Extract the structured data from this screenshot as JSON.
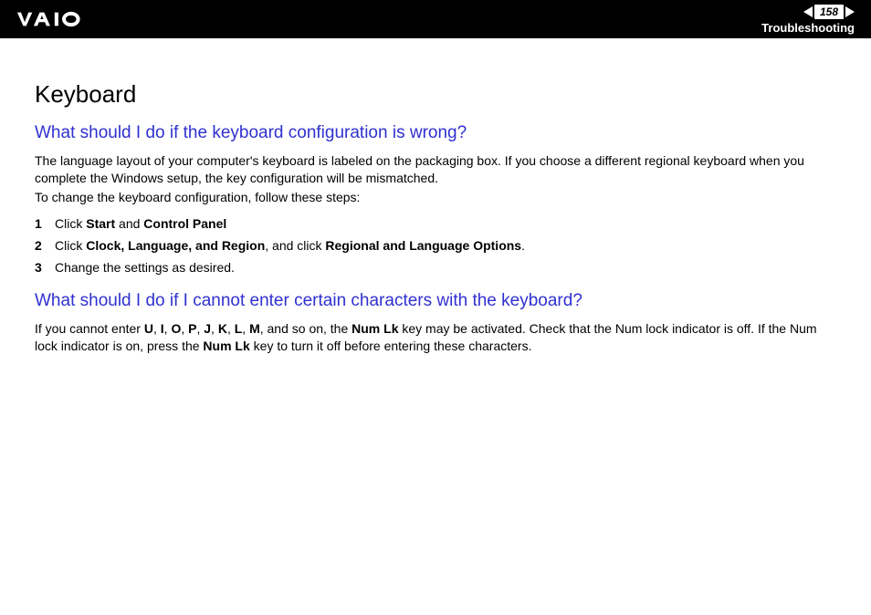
{
  "header": {
    "page_number": "158",
    "section": "Troubleshooting"
  },
  "title": "Keyboard",
  "q1": {
    "heading": "What should I do if the keyboard configuration is wrong?",
    "para1": "The language layout of your computer's keyboard is labeled on the packaging box. If you choose a different regional keyboard when you complete the Windows setup, the key configuration will be mismatched.",
    "para2": "To change the keyboard configuration, follow these steps:",
    "steps": [
      {
        "num": "1",
        "pre": "Click ",
        "b1": "Start",
        "mid1": " and ",
        "b2": "Control Panel",
        "post": ""
      },
      {
        "num": "2",
        "pre": "Click ",
        "b1": "Clock, Language, and Region",
        "mid1": ", and click ",
        "b2": "Regional and Language Options",
        "post": "."
      },
      {
        "num": "3",
        "pre": "Change the settings as desired.",
        "b1": "",
        "mid1": "",
        "b2": "",
        "post": ""
      }
    ]
  },
  "q2": {
    "heading": "What should I do if I cannot enter certain characters with the keyboard?",
    "p_pre": "If you cannot enter ",
    "chars": [
      "U",
      "I",
      "O",
      "P",
      "J",
      "K",
      "L",
      "M"
    ],
    "sep": ", ",
    "p_mid1": ", and so on, the ",
    "b1": "Num Lk",
    "p_mid2": " key may be activated. Check that the Num lock indicator is off. If the Num lock indicator is on, press the ",
    "b2": "Num Lk",
    "p_post": " key to turn it off before entering these characters."
  }
}
